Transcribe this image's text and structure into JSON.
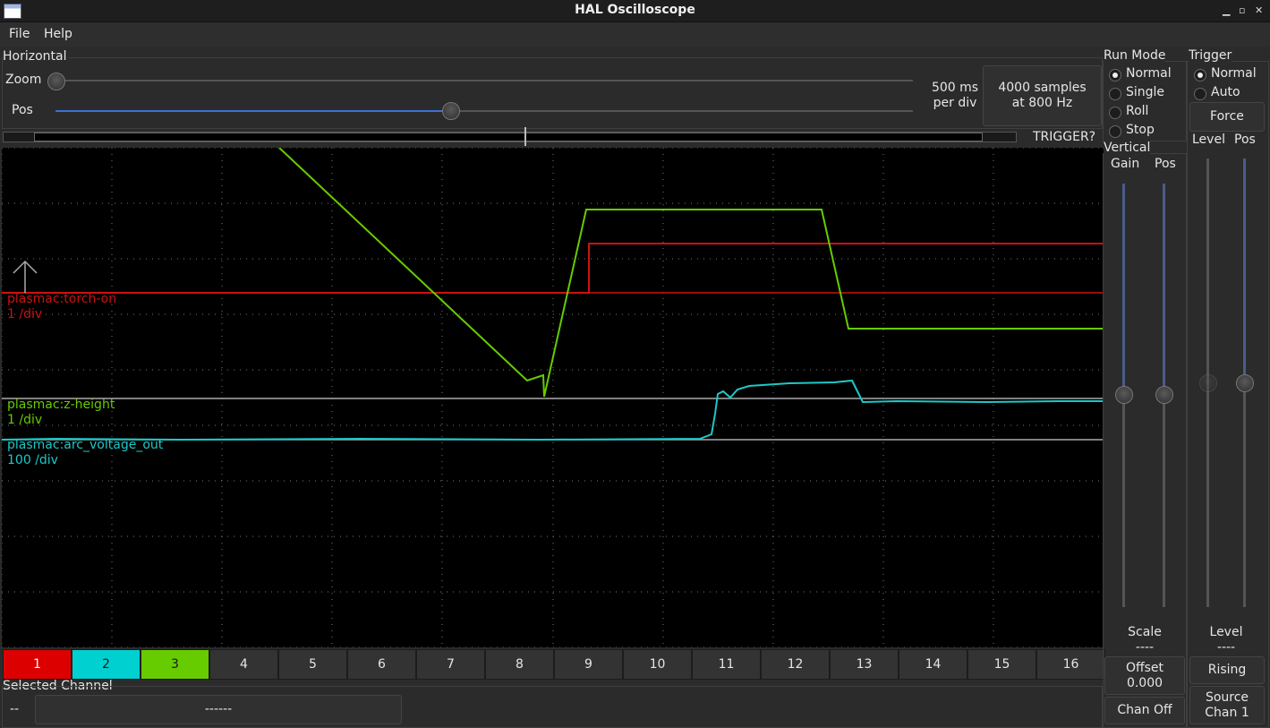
{
  "window": {
    "title": "HAL Oscilloscope"
  },
  "menu": [
    "File",
    "Help"
  ],
  "horizontal": {
    "group_label": "Horizontal",
    "zoom_label": "Zoom",
    "pos_label": "Pos",
    "zoom_fraction": 0.0,
    "pos_fraction": 0.46,
    "timebase_line1": "500 ms",
    "timebase_line2": "per div",
    "samples_line1": "4000 samples",
    "samples_line2": "at 800 Hz",
    "trigger_status": "TRIGGER?"
  },
  "run_mode": {
    "label": "Run Mode",
    "options": [
      "Normal",
      "Single",
      "Roll",
      "Stop"
    ],
    "selected": "Normal"
  },
  "trigger": {
    "label": "Trigger",
    "options": [
      "Normal",
      "Auto"
    ],
    "selected": "Normal",
    "force_button": "Force",
    "level_label": "Level",
    "pos_label": "Pos",
    "level_caption": "Level",
    "level_value": "----",
    "edge_button": "Rising",
    "source_line1": "Source",
    "source_line2": "Chan  1"
  },
  "vertical": {
    "label": "Vertical",
    "gain_label": "Gain",
    "pos_label": "Pos",
    "scale_label": "Scale",
    "scale_value": "----",
    "offset_line1": "Offset",
    "offset_line2": "0.000",
    "chan_off_button": "Chan Off"
  },
  "traces": [
    {
      "name": "plasmac:torch-on",
      "scale": "1 /div",
      "color": "#cc1111"
    },
    {
      "name": "plasmac:z-height",
      "scale": "1 /div",
      "color": "#66cc00"
    },
    {
      "name": "plasmac:arc_voltage_out",
      "scale": "100 /div",
      "color": "#1ec8c8"
    }
  ],
  "channels": {
    "labels": [
      "1",
      "2",
      "3",
      "4",
      "5",
      "6",
      "7",
      "8",
      "9",
      "10",
      "11",
      "12",
      "13",
      "14",
      "15",
      "16"
    ],
    "active_colors": [
      "#dd0000",
      "#00d0d0",
      "#66cc00"
    ]
  },
  "selected_channel": {
    "label": "Selected Channel",
    "number": "--",
    "name": "------"
  }
}
